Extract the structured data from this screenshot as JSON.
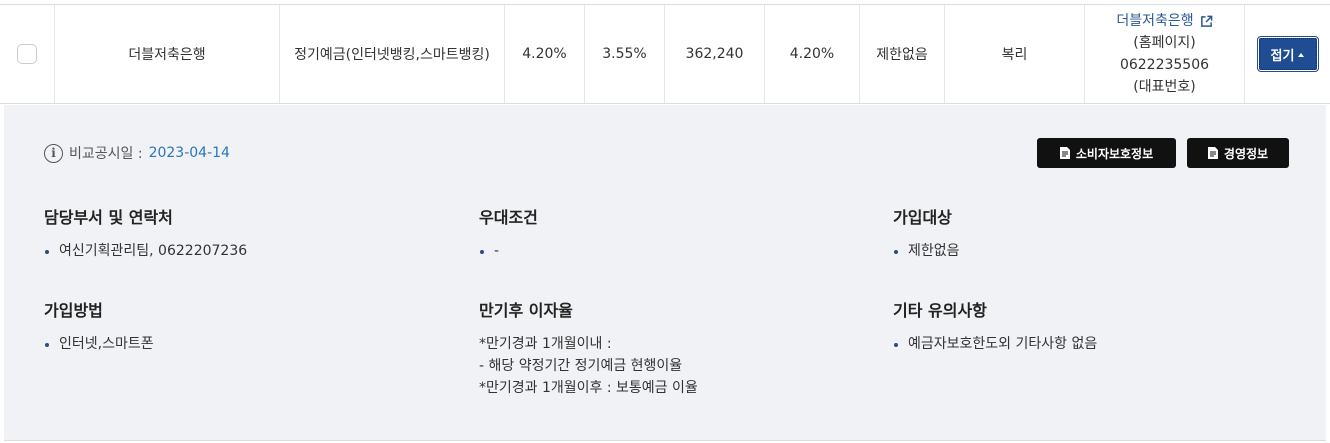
{
  "row": {
    "bank_name": "더블저축은행",
    "product_name": "정기예금(인터넷뱅킹,스마트뱅킹)",
    "rate_max": "4.20%",
    "rate_after_tax": "3.55%",
    "interest_amount": "362,240",
    "rate_max2": "4.20%",
    "limit": "제한없음",
    "interest_type": "복리",
    "bank_link": "더블저축은행",
    "homepage_label": "(홈페이지)",
    "phone": "0622235506",
    "phone_label": "(대표번호)",
    "fold_button": "접기"
  },
  "detail": {
    "info_label": "비교공시일 : ",
    "info_date": "2023-04-14",
    "btn_consumer": "소비자보호정보",
    "btn_management": "경영정보",
    "sections": {
      "contact": {
        "title": "담당부서 및 연락처",
        "item": "여신기획관리팀, 0622207236"
      },
      "preference": {
        "title": "우대조건",
        "item": "-"
      },
      "target": {
        "title": "가입대상",
        "item": "제한없음"
      },
      "method": {
        "title": "가입방법",
        "item": "인터넷,스마트폰"
      },
      "maturity": {
        "title": "만기후 이자율",
        "line1": "*만기경과 1개월이내 :",
        "line2": "- 해당 약정기간 정기예금 현행이율",
        "line3": "*만기경과 1개월이후 : 보통예금 이율"
      },
      "notes": {
        "title": "기타 유의사항",
        "item": "예금자보호한도외 기타사항 없음"
      }
    }
  },
  "colors": {
    "accent_blue": "#1f4c92",
    "link_blue": "#2b5797",
    "date_blue": "#2b76b9",
    "panel_bg": "#f0f2f6"
  }
}
